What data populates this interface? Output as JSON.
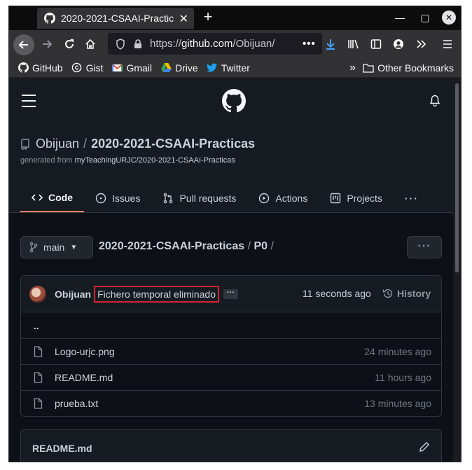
{
  "browser": {
    "tab_title": "2020-2021-CSAAI-Practic",
    "url_prefix": "https://",
    "url_host": "github.com",
    "url_path": "/Obijuan/",
    "bookmarks": [
      "GitHub",
      "Gist",
      "Gmail",
      "Drive",
      "Twitter"
    ],
    "other_bookmarks": "Other Bookmarks"
  },
  "repo": {
    "owner": "Obijuan",
    "separator": "/",
    "name": "2020-2021-CSAAI-Practicas",
    "generated_prefix": "generated from ",
    "generated_link": "myTeachingURJC/2020-2021-CSAAI-Practicas"
  },
  "tabs": {
    "code": "Code",
    "issues": "Issues",
    "pulls": "Pull requests",
    "actions": "Actions",
    "projects": "Projects",
    "more": "···"
  },
  "nav": {
    "branch": "main",
    "crumb_repo": "2020-2021-CSAAI-Practicas",
    "crumb_sep": " / ",
    "crumb_dir": "P0",
    "crumb_tail": " /",
    "more_label": "···"
  },
  "commit": {
    "author": "Obijuan",
    "message": "Fichero temporal eliminado",
    "ellipsis": "···",
    "time": "11 seconds ago",
    "history_label": "History"
  },
  "files": {
    "parent": "..",
    "items": [
      {
        "name": "Logo-urjc.png",
        "age": "24 minutes ago"
      },
      {
        "name": "README.md",
        "age": "11 hours ago"
      },
      {
        "name": "prueba.txt",
        "age": "13 minutes ago"
      }
    ]
  },
  "readme": {
    "title": "README.md"
  },
  "colors": {
    "page_bg": "#0d1117",
    "header_bg": "#161b22",
    "accent_underline": "#f78166",
    "highlight_box": "#d1242f",
    "download_icon": "#45a1ff"
  }
}
